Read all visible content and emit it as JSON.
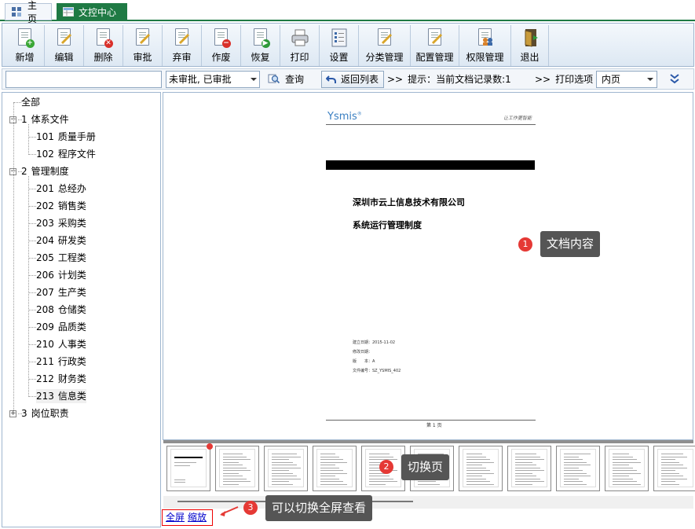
{
  "tabs": [
    {
      "label": "主页",
      "icon": "home-icon"
    },
    {
      "label": "文控中心",
      "icon": "table-icon"
    }
  ],
  "toolbar": [
    {
      "label": "新增",
      "icon": "new-doc-icon",
      "badge": "+",
      "badge_color": "#3aa735"
    },
    {
      "label": "编辑",
      "icon": "edit-doc-icon"
    },
    {
      "label": "删除",
      "icon": "delete-doc-icon",
      "badge": "✕",
      "badge_color": "#d9302a"
    },
    {
      "label": "审批",
      "icon": "approve-icon"
    },
    {
      "label": "弃审",
      "icon": "unapprove-icon"
    },
    {
      "label": "作废",
      "icon": "void-doc-icon",
      "badge": "−",
      "badge_color": "#d9302a"
    },
    {
      "label": "恢复",
      "icon": "restore-doc-icon",
      "badge": "▶",
      "badge_color": "#2e9a3a"
    },
    {
      "label": "打印",
      "icon": "printer-icon"
    },
    {
      "label": "设置",
      "icon": "settings-icon"
    },
    {
      "label": "分类管理",
      "icon": "category-icon"
    },
    {
      "label": "配置管理",
      "icon": "config-icon"
    },
    {
      "label": "权限管理",
      "icon": "permission-icon"
    },
    {
      "label": "退出",
      "icon": "exit-icon"
    }
  ],
  "search": {
    "input_value": "",
    "filter_value": "未审批, 已审批",
    "query_label": "查询",
    "back_label": "返回列表",
    "hint": "提示：当前文档记录数:1",
    "print_options": "打印选项",
    "page_select": "内页"
  },
  "tree": {
    "root": "全部",
    "groups": [
      {
        "code": "1",
        "name": "体系文件",
        "expanded": true,
        "children": [
          {
            "code": "101",
            "name": "质量手册"
          },
          {
            "code": "102",
            "name": "程序文件"
          }
        ]
      },
      {
        "code": "2",
        "name": "管理制度",
        "expanded": true,
        "children": [
          {
            "code": "201",
            "name": "总经办"
          },
          {
            "code": "202",
            "name": "销售类"
          },
          {
            "code": "203",
            "name": "采购类"
          },
          {
            "code": "204",
            "name": "研发类"
          },
          {
            "code": "205",
            "name": "工程类"
          },
          {
            "code": "206",
            "name": "计划类"
          },
          {
            "code": "207",
            "name": "生产类"
          },
          {
            "code": "208",
            "name": "仓储类"
          },
          {
            "code": "209",
            "name": "品质类"
          },
          {
            "code": "210",
            "name": "人事类"
          },
          {
            "code": "211",
            "name": "行政类"
          },
          {
            "code": "212",
            "name": "财务类"
          },
          {
            "code": "213",
            "name": "信息类"
          }
        ]
      },
      {
        "code": "3",
        "name": "岗位职责",
        "expanded": false,
        "children": []
      }
    ],
    "selected": "213"
  },
  "document": {
    "logo": "Ysmis",
    "logo_mark": "®",
    "header_right": "让工作更智能",
    "company": "深圳市云上信息技术有限公司",
    "title": "系统运行管理制度",
    "meta": [
      "建立日期：2015-11-02",
      "修改日期：",
      "版　　本：A",
      "文件编号：SZ_YSMIS_402"
    ],
    "footer": "第 1 页"
  },
  "thumbnail_count": 11,
  "bottom": {
    "fullscreen": "全屏",
    "zoom": "缩放"
  },
  "callouts": [
    {
      "num": "1",
      "text": "文档内容"
    },
    {
      "num": "2",
      "text": "切换页"
    },
    {
      "num": "3",
      "text": "可以切换全屏查看"
    }
  ],
  "colors": {
    "accent_green": "#1f7a44",
    "callout_bg": "#555555",
    "callout_num": "#e53935",
    "link": "#0000cc"
  }
}
